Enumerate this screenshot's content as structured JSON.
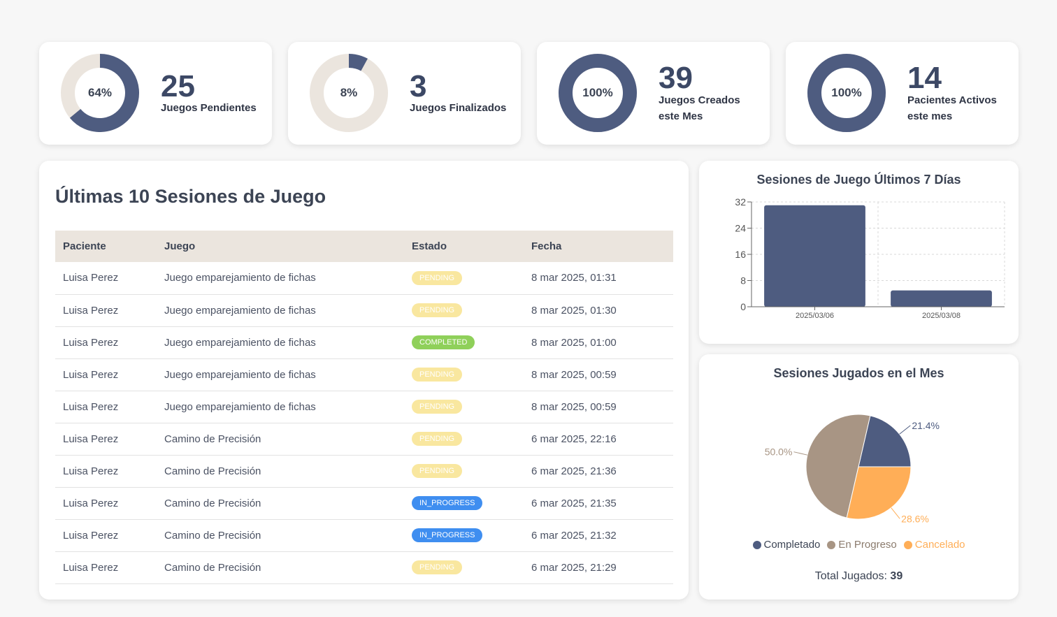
{
  "stats": [
    {
      "percent": 64,
      "percent_label": "64%",
      "value": "25",
      "label": "Juegos Pendientes"
    },
    {
      "percent": 8,
      "percent_label": "8%",
      "value": "3",
      "label": "Juegos Finalizados"
    },
    {
      "percent": 100,
      "percent_label": "100%",
      "value": "39",
      "label": "Juegos Creados este Mes"
    },
    {
      "percent": 100,
      "percent_label": "100%",
      "value": "14",
      "label": "Pacientes Activos este mes"
    }
  ],
  "colors": {
    "primary": "#4e5c80",
    "ring_track": "#ebe5de",
    "pending": "#f9e79f",
    "completed": "#8fd05a",
    "in_progress": "#3f8ef0",
    "pie_completado": "#4e5c80",
    "pie_en_progreso": "#a89584",
    "pie_cancelado": "#ffae57"
  },
  "sessions_table": {
    "title": "Últimas 10 Sesiones de Juego",
    "headers": [
      "Paciente",
      "Juego",
      "Estado",
      "Fecha"
    ],
    "rows": [
      {
        "patient": "Luisa Perez",
        "game": "Juego emparejamiento de fichas",
        "status": "PENDING",
        "status_class": "pending",
        "date": "8 mar 2025, 01:31"
      },
      {
        "patient": "Luisa Perez",
        "game": "Juego emparejamiento de fichas",
        "status": "PENDING",
        "status_class": "pending",
        "date": "8 mar 2025, 01:30"
      },
      {
        "patient": "Luisa Perez",
        "game": "Juego emparejamiento de fichas",
        "status": "COMPLETED",
        "status_class": "completed",
        "date": "8 mar 2025, 01:00"
      },
      {
        "patient": "Luisa Perez",
        "game": "Juego emparejamiento de fichas",
        "status": "PENDING",
        "status_class": "pending",
        "date": "8 mar 2025, 00:59"
      },
      {
        "patient": "Luisa Perez",
        "game": "Juego emparejamiento de fichas",
        "status": "PENDING",
        "status_class": "pending",
        "date": "8 mar 2025, 00:59"
      },
      {
        "patient": "Luisa Perez",
        "game": "Camino de Precisión",
        "status": "PENDING",
        "status_class": "pending",
        "date": "6 mar 2025, 22:16"
      },
      {
        "patient": "Luisa Perez",
        "game": "Camino de Precisión",
        "status": "PENDING",
        "status_class": "pending",
        "date": "6 mar 2025, 21:36"
      },
      {
        "patient": "Luisa Perez",
        "game": "Camino de Precisión",
        "status": "IN_PROGRESS",
        "status_class": "in_progress",
        "date": "6 mar 2025, 21:35"
      },
      {
        "patient": "Luisa Perez",
        "game": "Camino de Precisión",
        "status": "IN_PROGRESS",
        "status_class": "in_progress",
        "date": "6 mar 2025, 21:32"
      },
      {
        "patient": "Luisa Perez",
        "game": "Camino de Precisión",
        "status": "PENDING",
        "status_class": "pending",
        "date": "6 mar 2025, 21:29"
      }
    ]
  },
  "bar_chart": {
    "title": "Sesiones de Juego Últimos 7 Días"
  },
  "pie_chart": {
    "title": "Sesiones Jugados en el Mes",
    "total_label": "Total Jugados:",
    "total_value": "39"
  },
  "chart_data": [
    {
      "type": "bar",
      "title": "Sesiones de Juego Últimos 7 Días",
      "categories": [
        "2025/03/06",
        "2025/03/08"
      ],
      "values": [
        31,
        5
      ],
      "ylim": [
        0,
        32
      ],
      "yticks": [
        "0",
        "8",
        "16",
        "24",
        "32"
      ],
      "grid": true,
      "xlabel": "",
      "ylabel": ""
    },
    {
      "type": "pie",
      "title": "Sesiones Jugados en el Mes",
      "categories": [
        "Completado",
        "En Progreso",
        "Cancelado"
      ],
      "values": [
        21.4,
        50.0,
        28.6
      ],
      "value_labels": [
        "21.4%",
        "50.0%",
        "28.6%"
      ],
      "legend": "bottom"
    }
  ]
}
